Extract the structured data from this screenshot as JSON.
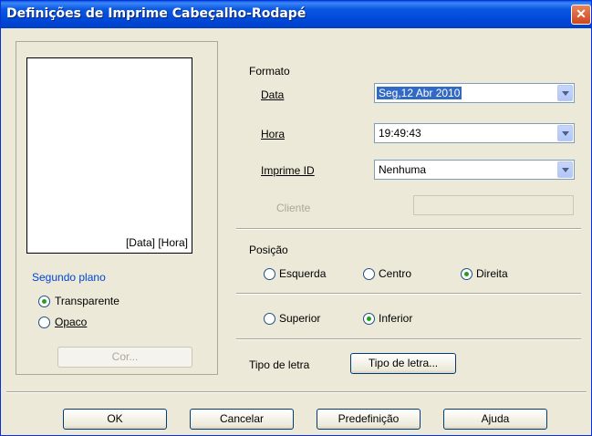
{
  "window": {
    "title": "Definições de Imprime Cabeçalho-Rodapé",
    "close_glyph": "✕"
  },
  "preview": {
    "text": "[Data] [Hora]"
  },
  "background": {
    "title": "Segundo plano",
    "transparent_label": "Transparente",
    "opaque_label": "Opaco",
    "color_button": "Cor...",
    "selected": "transparent"
  },
  "format": {
    "title": "Formato",
    "date_label": "Data",
    "date_value": "Seg,12 Abr 2010",
    "time_label": "Hora",
    "time_value": "19:49:43",
    "printid_label": "Imprime ID",
    "printid_value": "Nenhuma",
    "client_label": "Cliente"
  },
  "position": {
    "title": "Posição",
    "left_label": "Esquerda",
    "center_label": "Centro",
    "right_label": "Direita",
    "top_label": "Superior",
    "bottom_label": "Inferior",
    "horizontal_selected": "right",
    "vertical_selected": "bottom"
  },
  "font": {
    "label": "Tipo de letra",
    "button": "Tipo de letra..."
  },
  "footer": {
    "ok": "OK",
    "cancel": "Cancelar",
    "default": "Predefinição",
    "help": "Ajuda"
  }
}
